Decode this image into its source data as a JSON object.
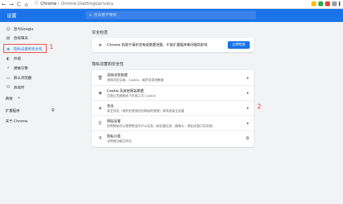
{
  "browser": {
    "back": "←",
    "forward": "→",
    "reload": "C",
    "home": "⌂",
    "site_label": "Chrome",
    "url_sep": "|",
    "url": "chrome://settings/privacy"
  },
  "header": {
    "title": "设置",
    "search_placeholder": "在设置中搜索"
  },
  "sidebar": {
    "items": [
      {
        "label": "您与Google"
      },
      {
        "label": "自动填充"
      },
      {
        "label": "隐私设置和安全性"
      },
      {
        "label": "外观"
      },
      {
        "label": "搜索引擎"
      },
      {
        "label": "默认浏览器"
      },
      {
        "label": "启动时"
      },
      {
        "label": "高级"
      },
      {
        "label": "扩展程序"
      },
      {
        "label": "关于 Chrome"
      }
    ]
  },
  "markers": {
    "one": "1",
    "two": "2"
  },
  "safety": {
    "title": "安全检查",
    "text": "Chrome 有助于保护您免受数据泄露、不良扩展程序等问题的影响",
    "button": "立即检查"
  },
  "privacy": {
    "title": "隐私设置和安全性",
    "rows": [
      {
        "t1": "清除浏览数据",
        "t2": "清除浏览记录、Cookie、缓存及其他数据"
      },
      {
        "t1": "Cookie 及其他网站数据",
        "t2": "已阻止无痕模式下的第三方 Cookie"
      },
      {
        "t1": "安全",
        "t2": "安全浏览（保护您免受危险网站的侵害）和其他安全设置"
      },
      {
        "t1": "网站设置",
        "t2": "控制网站可以使用和显示什么信息（如位置信息、摄像头、弹出式窗口及其他）"
      },
      {
        "t1": "隐私沙盒",
        "t2": "试用版功能已开启"
      }
    ]
  },
  "colors": {
    "accent": "#1a73e8",
    "highlight": "#e53935"
  }
}
